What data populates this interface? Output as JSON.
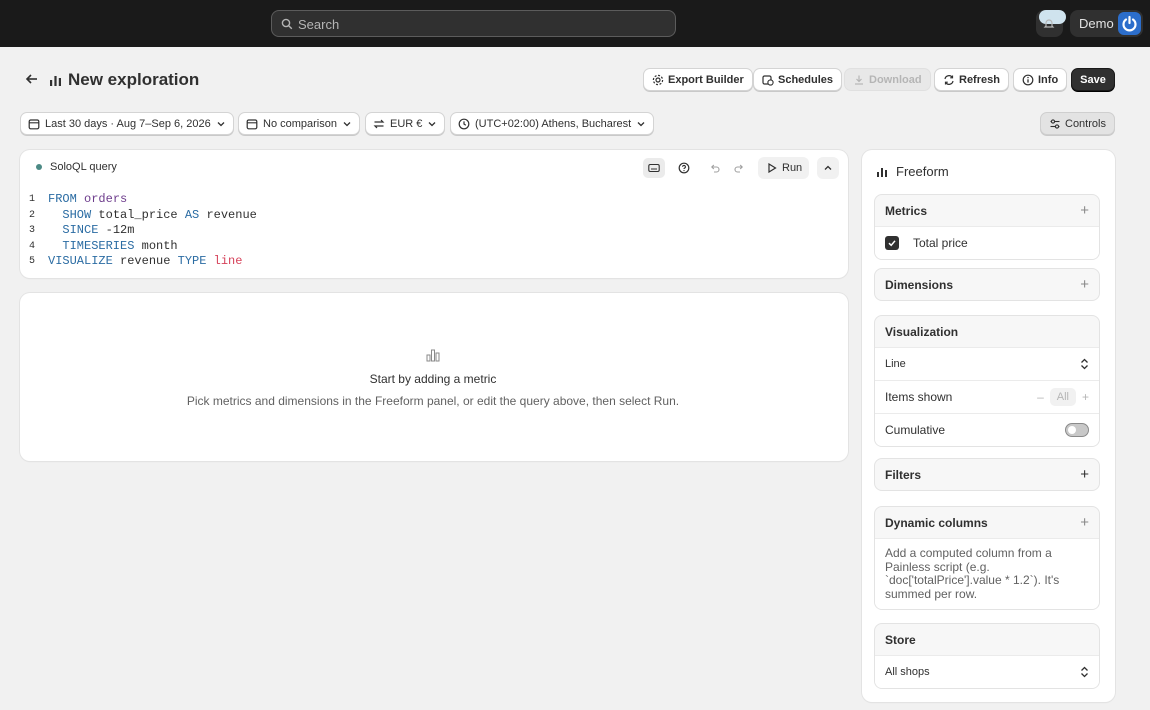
{
  "topbar": {
    "search_placeholder": "Search",
    "account_name": "Demo"
  },
  "header": {
    "title": "New exploration",
    "actions": {
      "export_builder": "Export Builder",
      "schedules": "Schedules",
      "download": "Download",
      "refresh": "Refresh",
      "info": "Info",
      "save": "Save"
    }
  },
  "filters": {
    "date_range": "Last 30 days · Aug 7–Sep 6, 2026",
    "comparison": "No comparison",
    "currency": "EUR €",
    "timezone": "(UTC+02:00) Athens, Bucharest",
    "controls": "Controls"
  },
  "query": {
    "label": "SoloQL query",
    "run": "Run",
    "status_color": "#4c8a85",
    "lines": [
      {
        "n": "1",
        "tokens": [
          {
            "t": "FROM",
            "c": "kw"
          },
          {
            "t": " ",
            "c": "plain"
          },
          {
            "t": "orders",
            "c": "id"
          }
        ]
      },
      {
        "n": "2",
        "tokens": [
          {
            "t": "  SHOW",
            "c": "kw"
          },
          {
            "t": " total_price ",
            "c": "plain"
          },
          {
            "t": "AS",
            "c": "kw"
          },
          {
            "t": " revenue",
            "c": "plain"
          }
        ]
      },
      {
        "n": "3",
        "tokens": [
          {
            "t": "  SINCE",
            "c": "kw"
          },
          {
            "t": " -12m",
            "c": "plain"
          }
        ]
      },
      {
        "n": "4",
        "tokens": [
          {
            "t": "  TIMESERIES",
            "c": "kw"
          },
          {
            "t": " month",
            "c": "plain"
          }
        ]
      },
      {
        "n": "5",
        "tokens": [
          {
            "t": "VISUALIZE",
            "c": "kw"
          },
          {
            "t": " revenue ",
            "c": "plain"
          },
          {
            "t": "TYPE",
            "c": "kw"
          },
          {
            "t": " ",
            "c": "plain"
          },
          {
            "t": "line",
            "c": "str"
          }
        ]
      }
    ]
  },
  "empty_state": {
    "title": "Start by adding a metric",
    "subtitle": "Pick metrics and dimensions in the Freeform panel, or edit the query above, then select Run."
  },
  "panel": {
    "title": "Freeform",
    "metrics": {
      "label": "Metrics",
      "items": [
        {
          "label": "Total price",
          "checked": true
        }
      ]
    },
    "dimensions": {
      "label": "Dimensions"
    },
    "visualization": {
      "label": "Visualization",
      "type": "Line",
      "items_shown_label": "Items shown",
      "items_shown_value": "All",
      "cumulative_label": "Cumulative",
      "cumulative_on": false
    },
    "filters": {
      "label": "Filters"
    },
    "dynamic_columns": {
      "label": "Dynamic columns",
      "description": "Add a computed column from a Painless script (e.g. `doc['totalPrice'].value * 1.2`). It's summed per row."
    },
    "store": {
      "label": "Store",
      "value": "All shops"
    }
  }
}
